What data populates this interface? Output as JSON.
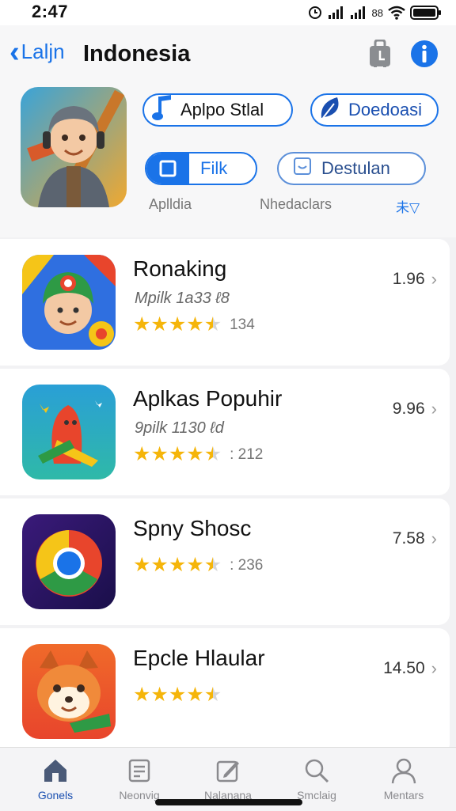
{
  "status_bar": {
    "time": "2:47",
    "battery_text": "88"
  },
  "nav": {
    "back_label": "Laljn",
    "title": "Indonesia"
  },
  "hero": {
    "button1_label": "Aplpo Stlal",
    "button2_label": "Doedoasi",
    "filter_label": "Filk",
    "second_filter_label": "Destulan",
    "sub_labels": [
      "Aplldia",
      "Nhedaclars",
      "未▽"
    ]
  },
  "apps": [
    {
      "name": "Ronaking",
      "meta": "Mpilk 1a33 ℓ8",
      "rating": 4.5,
      "rating_count": "134",
      "price": "1.96"
    },
    {
      "name": "Aplkas Popuhir",
      "meta": "9pilk 1130 ℓd",
      "rating": 4.5,
      "rating_count": ": 212",
      "price": "9.96"
    },
    {
      "name": "Spny Shosc",
      "meta": "",
      "rating": 4.5,
      "rating_count": ": 236",
      "price": "7.58"
    },
    {
      "name": "Epcle Hlaular",
      "meta": "",
      "rating": 4.5,
      "rating_count": "",
      "price": "14.50"
    }
  ],
  "tabs": [
    {
      "label": "Gonels",
      "active": true
    },
    {
      "label": "Neonvig",
      "active": false
    },
    {
      "label": "Nalanana",
      "active": false
    },
    {
      "label": "Smclaig",
      "active": false
    },
    {
      "label": "Mentars",
      "active": false
    }
  ],
  "colors": {
    "accent": "#1a73e8",
    "star": "#f5b50a"
  }
}
